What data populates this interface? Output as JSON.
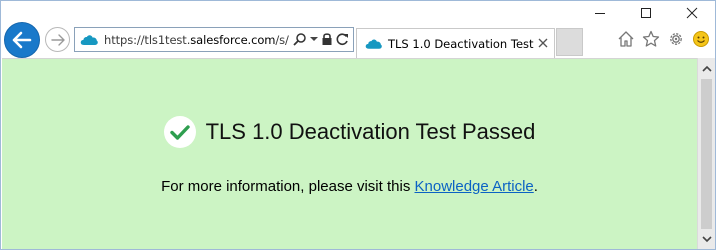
{
  "window": {
    "caption_buttons": [
      {
        "name": "minimize",
        "icon": "minimize-icon"
      },
      {
        "name": "maximize",
        "icon": "maximize-icon"
      },
      {
        "name": "close",
        "icon": "close-icon"
      }
    ]
  },
  "navigation": {
    "back_icon": "back-arrow-icon",
    "forward_icon": "forward-arrow-icon"
  },
  "address_bar": {
    "url_prefix": "https://tls1test.",
    "url_host": "salesforce.com",
    "url_suffix": "/s/",
    "site_icon": "salesforce-cloud-icon",
    "tools": [
      "search-icon",
      "dropdown-icon",
      "lock-icon",
      "refresh-icon"
    ]
  },
  "tab": {
    "title": "TLS 1.0 Deactivation Test",
    "favicon": "salesforce-cloud-icon"
  },
  "toolbar": {
    "icons": [
      "home-icon",
      "favorites-star-icon",
      "settings-gear-icon",
      "smiley-feedback-icon"
    ]
  },
  "content": {
    "background_color": "#ccf4c4",
    "heading": "TLS 1.0 Deactivation Test Passed",
    "info_text": "For more information, please visit this ",
    "link_text": "Knowledge Article",
    "info_end": ".",
    "check_color": "#2e9e4f",
    "link_color": "#0b62c4"
  },
  "colors": {
    "back_button": "#1979ca",
    "brand_cloud": "#1798c1"
  }
}
